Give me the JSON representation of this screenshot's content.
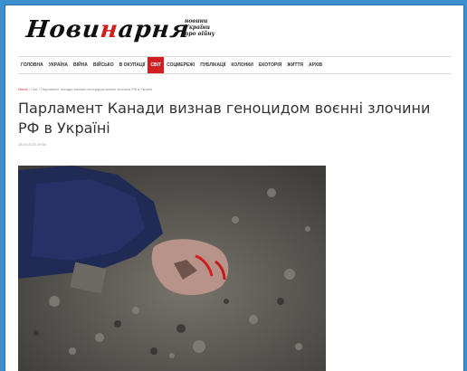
{
  "site": {
    "logo_dark": "Нови",
    "logo_red": "н",
    "logo_dark2": "арня",
    "tagline": "новини України про війну"
  },
  "nav": [
    {
      "label": "ГОЛОВНА"
    },
    {
      "label": "УКРАЇНА"
    },
    {
      "label": "ВІЙНА"
    },
    {
      "label": "ВІЙСЬКО"
    },
    {
      "label": "В ОКУПАЦІЇ"
    },
    {
      "label": "СВІТ",
      "active": true
    },
    {
      "label": "СОЦМЕРЕЖІ"
    },
    {
      "label": "ПУБЛІКАЦІЇ"
    },
    {
      "label": "КОЛОНКИ"
    },
    {
      "label": "ЕКОТОРІЯ"
    },
    {
      "label": "ЖИТТЯ"
    },
    {
      "label": "АРХІВ"
    }
  ],
  "article": {
    "breadcrumb_home": "Home",
    "breadcrumb_rest": " / Світ / Парламент Канади визнав геноцидом воєнні злочини РФ в Україні",
    "title": "Парламент Канади визнав геноцидом воєнні злочини РФ в Україні",
    "date": "28.04.2022 09:00",
    "image_alt": "photo-debris"
  },
  "colors": {
    "accent": "#d11f1f",
    "frame_bg": "#3d8fd0"
  }
}
